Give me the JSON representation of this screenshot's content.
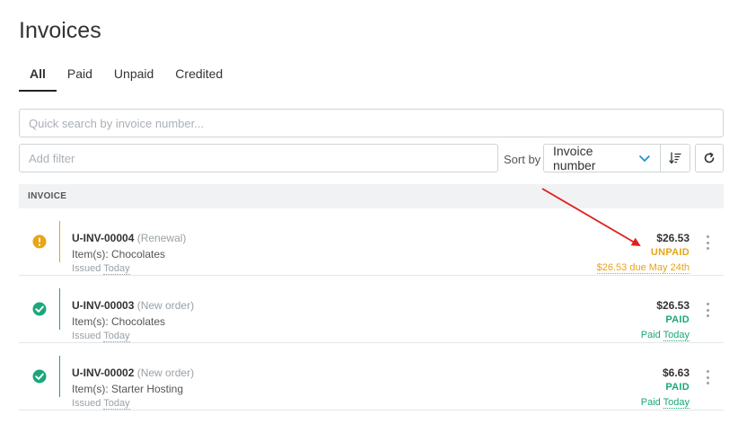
{
  "page": {
    "title": "Invoices"
  },
  "tabs": [
    {
      "label": "All",
      "active": true
    },
    {
      "label": "Paid",
      "active": false
    },
    {
      "label": "Unpaid",
      "active": false
    },
    {
      "label": "Credited",
      "active": false
    }
  ],
  "search": {
    "placeholder": "Quick search by invoice number..."
  },
  "filter": {
    "placeholder": "Add filter"
  },
  "sort": {
    "label": "Sort by",
    "selected": "Invoice number",
    "order_icon": "sort-descending-icon"
  },
  "refresh": {
    "icon": "refresh-icon"
  },
  "table": {
    "header": "INVOICE",
    "rows": [
      {
        "id": "U-INV-00004",
        "type": "(Renewal)",
        "items": "Item(s): Chocolates",
        "issued_prefix": "Issued",
        "issued_when": "Today",
        "amount": "$26.53",
        "status": "UNPAID",
        "note_prefix": "",
        "note": "$26.53 due May 24th",
        "status_icon": "warning-icon",
        "color": "#e8a317"
      },
      {
        "id": "U-INV-00003",
        "type": "(New order)",
        "items": "Item(s): Chocolates",
        "issued_prefix": "Issued",
        "issued_when": "Today",
        "amount": "$26.53",
        "status": "PAID",
        "note_prefix": "Paid",
        "note": "Today",
        "status_icon": "check-circle-icon",
        "color": "#1aa77a"
      },
      {
        "id": "U-INV-00002",
        "type": "(New order)",
        "items": "Item(s): Starter Hosting",
        "issued_prefix": "Issued",
        "issued_when": "Today",
        "amount": "$6.63",
        "status": "PAID",
        "note_prefix": "Paid",
        "note": "Today",
        "status_icon": "check-circle-icon",
        "color": "#1aa77a"
      }
    ]
  },
  "annotation": {
    "arrow_color": "#e02020"
  }
}
